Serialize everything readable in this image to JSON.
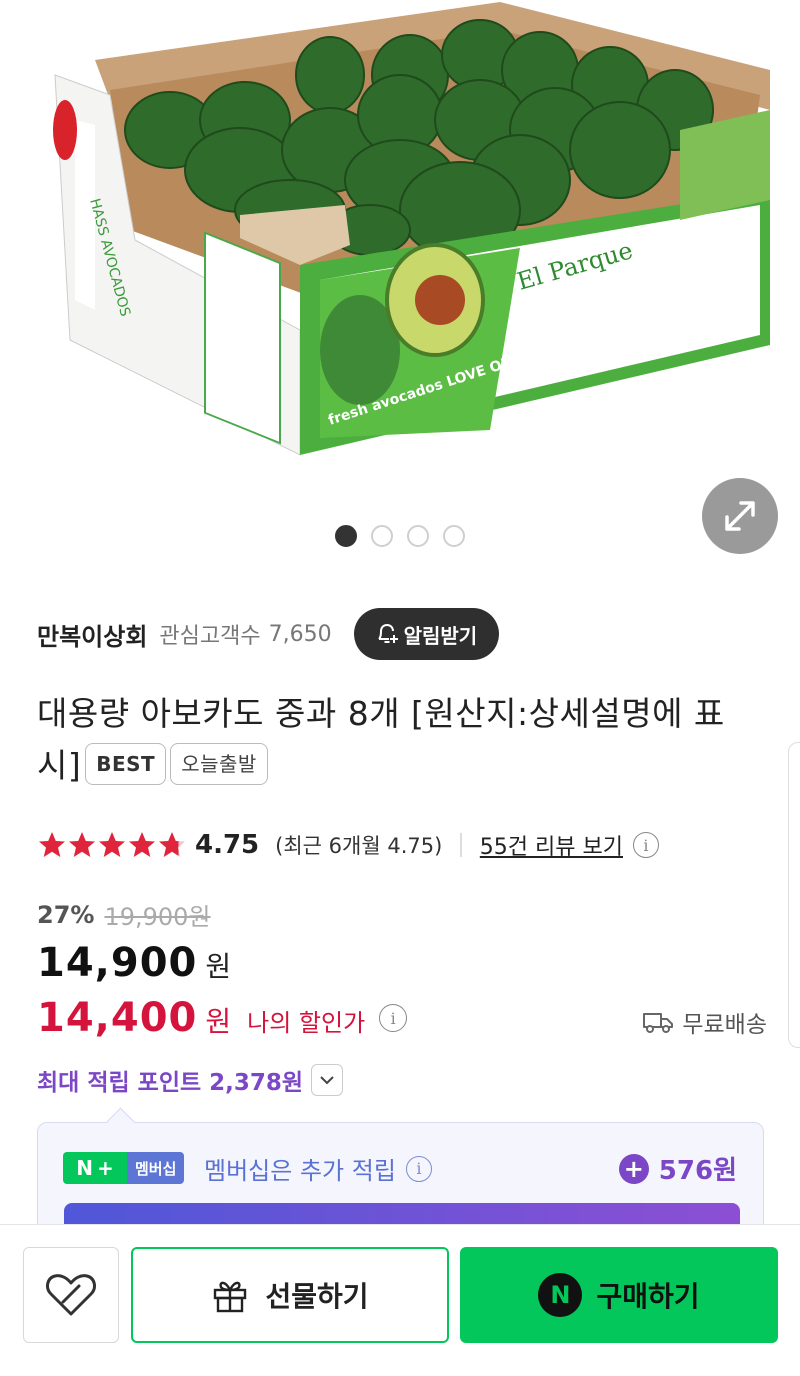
{
  "product_image": {
    "box_brand": "El Parque",
    "box_side_text": "fresh avocados LOVE ONE TODAY",
    "box_end_text": "HASS AVOCADOS"
  },
  "carousel": {
    "count": 4,
    "active_index": 0
  },
  "seller": {
    "name": "만복이상회",
    "follower_label": "관심고객수",
    "follower_count": "7,650",
    "notify_label": "알림받기"
  },
  "product": {
    "title": "대용량 아보카도 중과 8개 [원산지:상세설명에 표시]",
    "tags": [
      "BEST",
      "오늘출발"
    ]
  },
  "rating": {
    "stars": 4.75,
    "score": "4.75",
    "recent": "(최근 6개월 4.75)",
    "review_link": "55건 리뷰 보기"
  },
  "price": {
    "discount_pct": "27%",
    "original": "19,900원",
    "sale": "14,900",
    "currency": "원",
    "my_price": "14,400",
    "my_price_label": "나의 할인가",
    "shipping": "무료배송"
  },
  "points": {
    "text": "최대 적립 포인트 2,378원"
  },
  "membership": {
    "badge_n": "N",
    "badge_text": "멤버십",
    "text": "멤버십은 추가 적립",
    "amount": "576원"
  },
  "bottom_bar": {
    "gift_label": "선물하기",
    "buy_label": "구매하기",
    "buy_icon_letter": "N"
  },
  "colors": {
    "naver_green": "#03c75a",
    "discount_red": "#d4143c",
    "points_purple": "#7c47c6",
    "star_red": "#e0243c"
  }
}
